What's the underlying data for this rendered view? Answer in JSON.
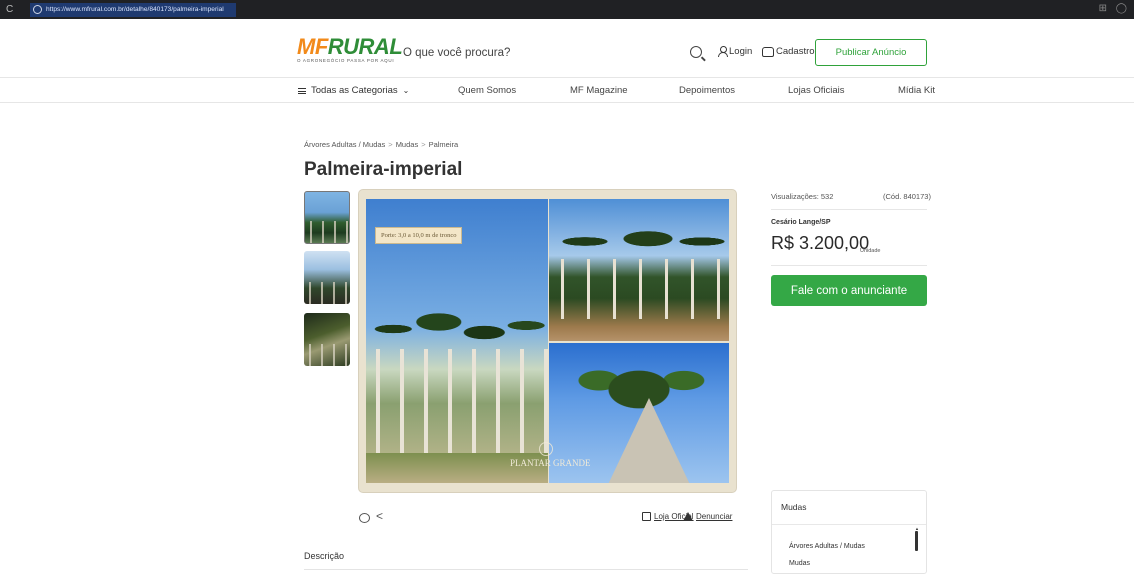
{
  "browser": {
    "url": "https://www.mfrural.com.br/detalhe/840173/palmeira-imperial",
    "reload_icon": "reload-icon"
  },
  "header": {
    "logo_mf": "MF",
    "logo_rural": "RURAL",
    "logo_tagline": "O AGRONEGÓCIO PASSA POR AQUI",
    "search_placeholder": "O que você procura?",
    "login_label": "Login",
    "cadastro_label": "Cadastro",
    "publish_label": "Publicar Anúncio",
    "accent_color": "#2fa23a",
    "brand_orange": "#f28a1a"
  },
  "nav": {
    "categories_label": "Todas as Categorias",
    "items": [
      "Quem Somos",
      "MF Magazine",
      "Depoimentos",
      "Lojas Oficiais",
      "Mídia Kit"
    ]
  },
  "breadcrumb": [
    "Árvores Adultas / Mudas",
    "Mudas",
    "Palmeira"
  ],
  "product": {
    "title": "Palmeira-imperial",
    "image_caption": "Porte: 3,0 a 10,0 m de tronco",
    "image_brand": "PLANTAR GRANDE",
    "views": "Visualizações: 532",
    "code": "(Cód. 840173)",
    "location": "Cesário Lange/SP",
    "price": "R$ 3.200,00",
    "unit": "Unidade",
    "contact_label": "Fale com o anunciante"
  },
  "actions": {
    "loja_label": "Loja Oficial",
    "denunciar_label": "Denunciar"
  },
  "description_title": "Descrição",
  "category_box": {
    "title": "Mudas",
    "items": [
      "Árvores Adultas / Mudas",
      "Mudas"
    ]
  }
}
